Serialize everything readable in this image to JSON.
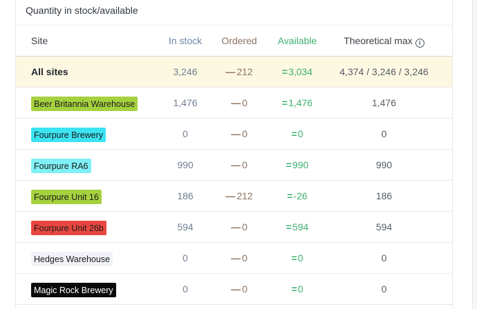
{
  "card": {
    "title": "Quantity in stock/available"
  },
  "columns": {
    "site": "Site",
    "in_stock": "In stock",
    "ordered": "Ordered",
    "available": "Available",
    "theoretical_max": "Theoretical max",
    "info_icon": "info-icon"
  },
  "symbols": {
    "ordered_prefix": "—",
    "available_prefix": "="
  },
  "all_sites": {
    "label": "All sites",
    "in_stock": "3,246",
    "ordered": "212",
    "available": "3,034",
    "theoretical_max": "4,374 / 3,246 / 3,246",
    "highlight_color": "#fdf8e1"
  },
  "rows": [
    {
      "site": "Beer Britannia Warehouse",
      "badge_color": "#a6d13f",
      "badge_text_color": "#1a1a1a",
      "in_stock": "1,476",
      "ordered": "0",
      "available": "1,476",
      "theoretical_max": "1,476"
    },
    {
      "site": "Fourpure Brewery",
      "badge_color": "#3ce3f1",
      "badge_text_color": "#1a1a1a",
      "in_stock": "0",
      "ordered": "0",
      "available": "0",
      "theoretical_max": "0"
    },
    {
      "site": "Fourpure RA6",
      "badge_color": "#7ff0f5",
      "badge_text_color": "#1a1a1a",
      "in_stock": "990",
      "ordered": "0",
      "available": "990",
      "theoretical_max": "990"
    },
    {
      "site": "Fourpure Unit 16",
      "badge_color": "#a6d13f",
      "badge_text_color": "#1a1a1a",
      "in_stock": "186",
      "ordered": "212",
      "available": "-26",
      "theoretical_max": "186"
    },
    {
      "site": "Fourpure Unit 26b",
      "badge_color": "#e8473f",
      "badge_text_color": "#1a1a1a",
      "in_stock": "594",
      "ordered": "0",
      "available": "594",
      "theoretical_max": "594"
    },
    {
      "site": "Hedges Warehouse",
      "badge_color": "#f1f3f8",
      "badge_text_color": "#1a1a1a",
      "in_stock": "0",
      "ordered": "0",
      "available": "0",
      "theoretical_max": "0"
    },
    {
      "site": "Magic Rock Brewery",
      "badge_color": "#0a0a0a",
      "badge_text_color": "#ffffff",
      "in_stock": "0",
      "ordered": "0",
      "available": "0",
      "theoretical_max": "0"
    }
  ],
  "colors": {
    "in_stock": "#6f7f93",
    "ordered": "#8b7260",
    "available": "#3cb06f"
  }
}
